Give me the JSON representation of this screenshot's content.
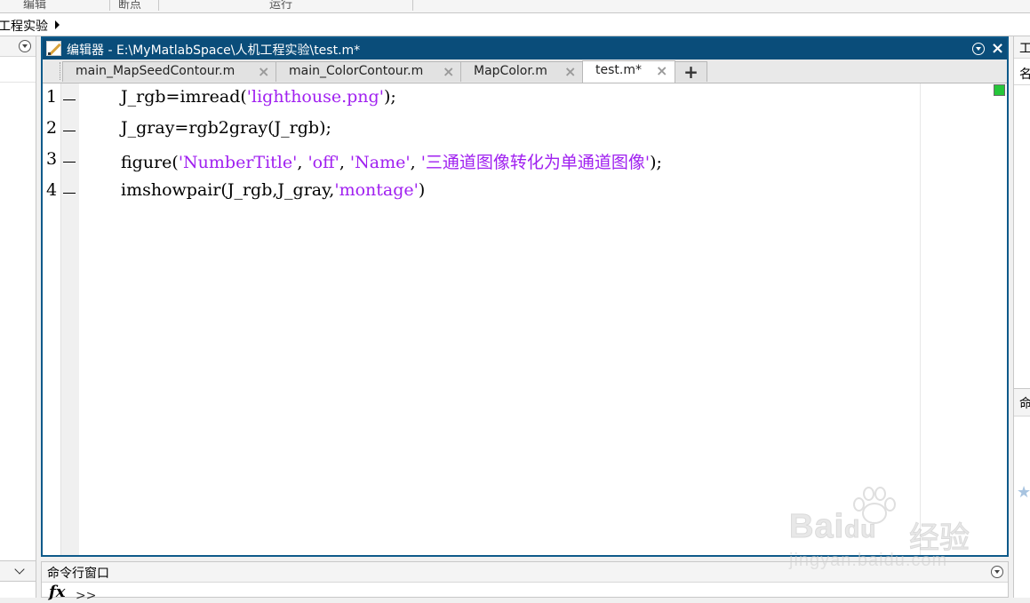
{
  "toolstrip": {
    "sections": [
      "编辑",
      "断点",
      "运行"
    ]
  },
  "address_bar": {
    "path_text": "工程实验"
  },
  "editor": {
    "title": "编辑器 - E:\\MyMatlabSpace\\人机工程实验\\test.m*",
    "tabs": [
      {
        "label": "main_MapSeedContour.m",
        "active": false
      },
      {
        "label": "main_ColorContour.m",
        "active": false
      },
      {
        "label": "MapColor.m",
        "active": false
      },
      {
        "label": "test.m*",
        "active": true
      }
    ],
    "add_tab_label": "+",
    "lines": [
      {
        "num": "1",
        "parts": [
          [
            "J_rgb=imread(",
            "code"
          ],
          [
            "'lighthouse.png'",
            "str"
          ],
          [
            ");",
            "code"
          ]
        ]
      },
      {
        "num": "2",
        "parts": [
          [
            "J_gray=rgb2gray(J_rgb);",
            "code"
          ]
        ]
      },
      {
        "num": "3",
        "parts": [
          [
            "figure(",
            "code"
          ],
          [
            "'NumberTitle'",
            "str"
          ],
          [
            ", ",
            "code"
          ],
          [
            "'off'",
            "str"
          ],
          [
            ", ",
            "code"
          ],
          [
            "'Name'",
            "str"
          ],
          [
            ", ",
            "code"
          ],
          [
            "'三通道图像转化为单通道图像'",
            "str"
          ],
          [
            ");",
            "code"
          ]
        ]
      },
      {
        "num": "4",
        "parts": [
          [
            "imshowpair(J_rgb,J_gray,",
            "code"
          ],
          [
            "'montage'",
            "str"
          ],
          [
            ")",
            "code"
          ]
        ]
      }
    ],
    "status_color": "#26c63a"
  },
  "command_window": {
    "title": "命令行窗口",
    "fx_label": "fx",
    "prompt": ">>"
  },
  "right_panel": {
    "head1": "工",
    "head2": "名",
    "head3": "命"
  },
  "watermark": {
    "brand": "Bai",
    "brand2": "du",
    "cn": "经验",
    "url": "jingyan.baidu.com"
  },
  "colors": {
    "title_bar": "#0a4d7a",
    "string_literal": "#a020f0"
  }
}
